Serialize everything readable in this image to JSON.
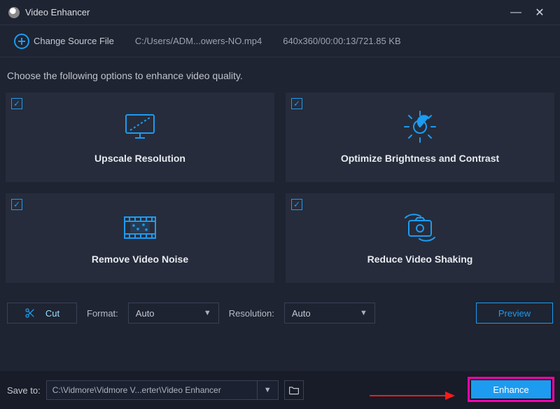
{
  "app": {
    "title": "Video Enhancer"
  },
  "source": {
    "change_label": "Change Source File",
    "path": "C:/Users/ADM...owers-NO.mp4",
    "meta": "640x360/00:00:13/721.85 KB"
  },
  "hint": "Choose the following options to enhance video quality.",
  "cards": [
    {
      "label": "Upscale Resolution",
      "icon": "monitor",
      "checked": true
    },
    {
      "label": "Optimize Brightness and Contrast",
      "icon": "sun",
      "checked": true
    },
    {
      "label": "Remove Video Noise",
      "icon": "film",
      "checked": true
    },
    {
      "label": "Reduce Video Shaking",
      "icon": "camera",
      "checked": true
    }
  ],
  "controls": {
    "cut_label": "Cut",
    "format_label": "Format:",
    "format_value": "Auto",
    "resolution_label": "Resolution:",
    "resolution_value": "Auto",
    "preview_label": "Preview"
  },
  "footer": {
    "save_to_label": "Save to:",
    "save_path": "C:\\Vidmore\\Vidmore V...erter\\Video Enhancer",
    "enhance_label": "Enhance"
  },
  "colors": {
    "accent": "#1d9bf0"
  }
}
